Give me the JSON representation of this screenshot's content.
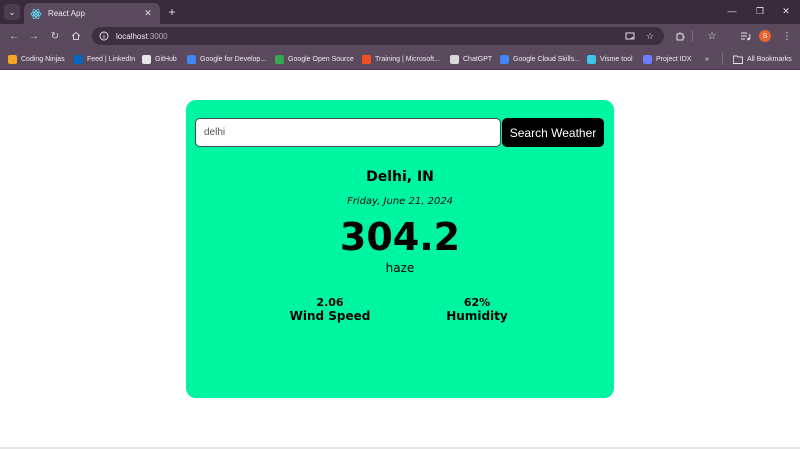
{
  "browser": {
    "tab_title": "React App",
    "url_host": "localhost",
    "url_port": ":3000",
    "profile_initial": "S",
    "bookmarks": [
      {
        "label": "Coding Ninjas",
        "color": "#f5a623"
      },
      {
        "label": "Feed | LinkedIn",
        "color": "#0a66c2"
      },
      {
        "label": "GitHub",
        "color": "#e8e8e8"
      },
      {
        "label": "Google for Develop...",
        "color": "#4285f4"
      },
      {
        "label": "Google Open Source",
        "color": "#34a853"
      },
      {
        "label": "Training | Microsoft...",
        "color": "#f25022"
      },
      {
        "label": "ChatGPT",
        "color": "#d9d9d9"
      },
      {
        "label": "Google Cloud Skills...",
        "color": "#4285f4"
      },
      {
        "label": "Visme tool",
        "color": "#3ec3e9"
      },
      {
        "label": "Project IDX",
        "color": "#6d7cff"
      }
    ],
    "all_bookmarks_label": "All Bookmarks"
  },
  "weather": {
    "search_value": "delhi",
    "search_button_label": "Search Weather",
    "city": "Delhi, IN",
    "date": "Friday, June 21, 2024",
    "temperature": "304.2",
    "condition": "haze",
    "wind_value": "2.06",
    "wind_label": "Wind Speed",
    "humidity_value": "62%",
    "humidity_label": "Humidity"
  },
  "colors": {
    "card_bg": "#00f5a0",
    "button_bg": "#000000",
    "chrome_bg": "#5b4a5d"
  }
}
